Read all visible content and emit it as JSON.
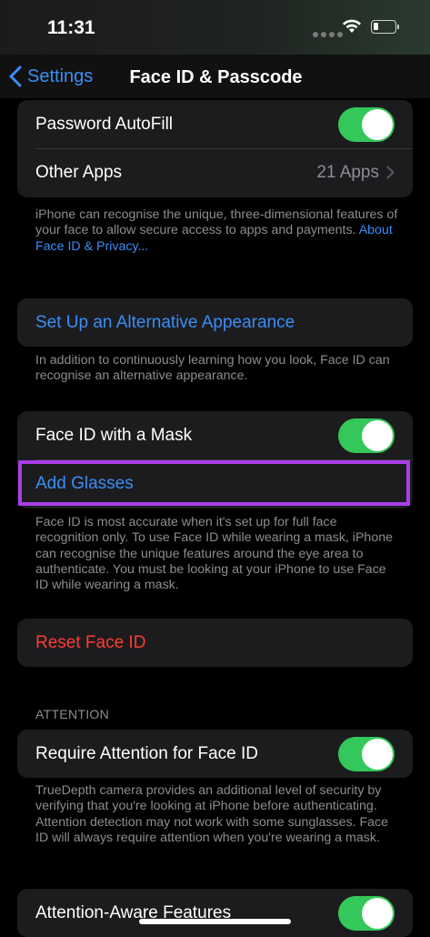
{
  "status_bar": {
    "time": "11:31"
  },
  "nav": {
    "back_label": "Settings",
    "title": "Face ID & Passcode"
  },
  "group1": {
    "password_autofill": {
      "label": "Password AutoFill",
      "on": true
    },
    "other_apps": {
      "label": "Other Apps",
      "value": "21 Apps"
    }
  },
  "footer1": {
    "text": "iPhone can recognise the unique, three-dimensional features of your face to allow secure access to apps and payments.",
    "link": "About Face ID & Privacy..."
  },
  "alt_appearance": {
    "label": "Set Up an Alternative Appearance"
  },
  "footer2": {
    "text": "In addition to continuously learning how you look, Face ID can recognise an alternative appearance."
  },
  "group3": {
    "mask": {
      "label": "Face ID with a Mask",
      "on": true
    },
    "glasses": {
      "label": "Add Glasses"
    }
  },
  "footer3": {
    "text": "Face ID is most accurate when it's set up for full face recognition only. To use Face ID while wearing a mask, iPhone can recognise the unique features around the eye area to authenticate. You must be looking at your iPhone to use Face ID while wearing a mask."
  },
  "reset": {
    "label": "Reset Face ID"
  },
  "attention": {
    "header": "ATTENTION",
    "require": {
      "label": "Require Attention for Face ID",
      "on": true
    },
    "footer": "TrueDepth camera provides an additional level of security by verifying that you're looking at iPhone before authenticating. Attention detection may not work with some sunglasses. Face ID will always require attention when you're wearing a mask.",
    "aware": {
      "label": "Attention-Aware Features",
      "on": true
    }
  },
  "colors": {
    "accent": "#3a8ef6",
    "toggle_on": "#34c759",
    "destructive": "#ff3b30",
    "highlight": "#a93ee8"
  }
}
